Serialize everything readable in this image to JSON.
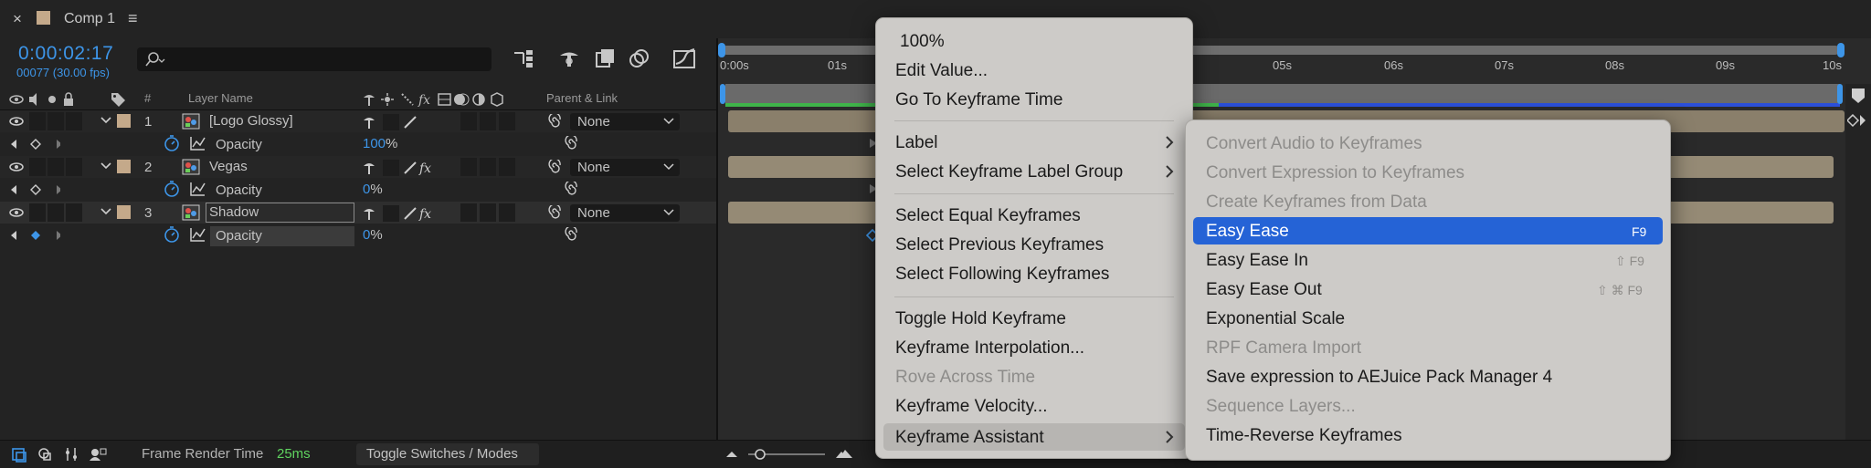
{
  "panel": {
    "comp_tab": {
      "close": "×",
      "title": "Comp 1",
      "menu": "≡"
    },
    "time": {
      "current": "0:00:02:17",
      "frames": "00077 (30.00 fps)"
    },
    "search": {
      "placeholder": "",
      "icon": "search-icon"
    },
    "columns": {
      "hash": "#",
      "layer_name": "Layer Name",
      "parent_link": "Parent & Link"
    },
    "layers": [
      {
        "index": "1",
        "name": "[Logo Glossy]",
        "parent": "None",
        "prop_name": "Opacity",
        "prop_value": "100",
        "prop_unit": "%"
      },
      {
        "index": "2",
        "name": "Vegas",
        "parent": "None",
        "prop_name": "Opacity",
        "prop_value": "0",
        "prop_unit": "%"
      },
      {
        "index": "3",
        "name": "Shadow",
        "parent": "None",
        "prop_name": "Opacity",
        "prop_value": "0",
        "prop_unit": "%"
      }
    ],
    "ruler": [
      "0:00s",
      "01s",
      "05s",
      "06s",
      "07s",
      "08s",
      "09s",
      "10s"
    ],
    "bottom": {
      "frame_render_label": "Frame Render Time",
      "frame_render_value": "25ms",
      "toggle_label": "Toggle Switches / Modes"
    },
    "colors": {
      "accent_blue": "#3d95e8",
      "layer_label_tan": "#c4a98a",
      "menu_highlight": "#2563d6",
      "render_time_green": "#5fd35f"
    }
  },
  "context_menu": {
    "items": [
      {
        "label": "100%",
        "enabled": true
      },
      {
        "label": "Edit Value...",
        "enabled": true
      },
      {
        "label": "Go To Keyframe Time",
        "enabled": true
      },
      {
        "label": "Label",
        "enabled": true,
        "submenu": true
      },
      {
        "label": "Select Keyframe Label Group",
        "enabled": true,
        "submenu": true
      },
      {
        "label": "Select Equal Keyframes",
        "enabled": true
      },
      {
        "label": "Select Previous Keyframes",
        "enabled": true
      },
      {
        "label": "Select Following Keyframes",
        "enabled": true
      },
      {
        "label": "Toggle Hold Keyframe",
        "enabled": true
      },
      {
        "label": "Keyframe Interpolation...",
        "enabled": true
      },
      {
        "label": "Rove Across Time",
        "enabled": false
      },
      {
        "label": "Keyframe Velocity...",
        "enabled": true
      },
      {
        "label": "Keyframe Assistant",
        "enabled": true,
        "submenu": true,
        "active": true
      }
    ]
  },
  "submenu": {
    "items": [
      {
        "label": "Convert Audio to Keyframes",
        "enabled": false
      },
      {
        "label": "Convert Expression to Keyframes",
        "enabled": false
      },
      {
        "label": "Create Keyframes from Data",
        "enabled": false
      },
      {
        "label": "Easy Ease",
        "enabled": true,
        "shortcut": "F9",
        "highlighted": true
      },
      {
        "label": "Easy Ease In",
        "enabled": true,
        "shortcut": "⇧ F9"
      },
      {
        "label": "Easy Ease Out",
        "enabled": true,
        "shortcut": "⇧ ⌘ F9"
      },
      {
        "label": "Exponential Scale",
        "enabled": true
      },
      {
        "label": "RPF Camera Import",
        "enabled": false
      },
      {
        "label": "Save expression to AEJuice Pack Manager 4",
        "enabled": true
      },
      {
        "label": "Sequence Layers...",
        "enabled": false
      },
      {
        "label": "Time-Reverse Keyframes",
        "enabled": true
      }
    ]
  }
}
